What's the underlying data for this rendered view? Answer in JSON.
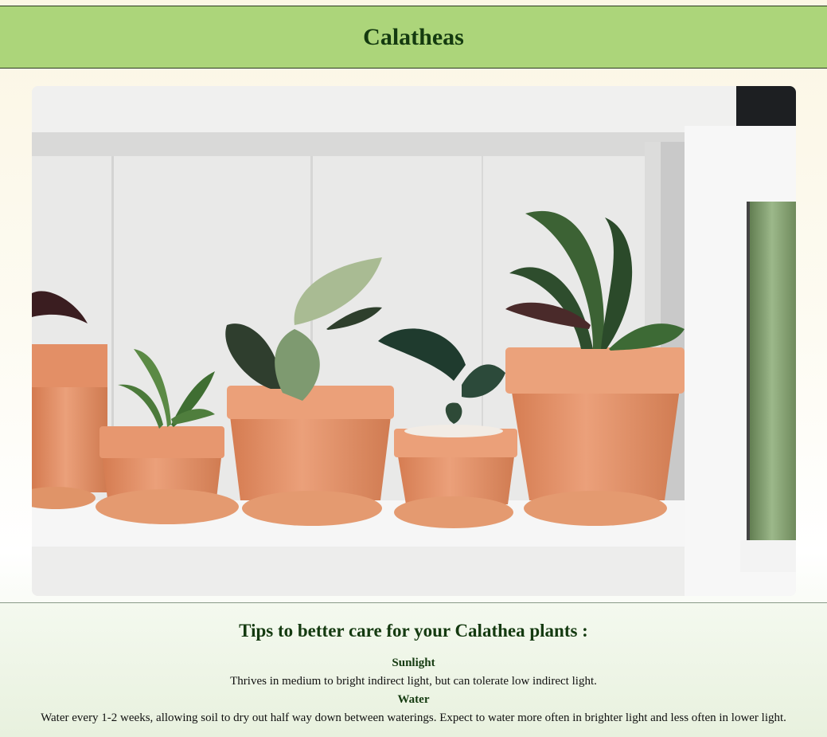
{
  "header": {
    "title": "Calatheas"
  },
  "hero_image": {
    "alt": "Calathea plants in terracotta pots on a white shelf"
  },
  "tips": {
    "heading": "Tips to better care for your Calathea plants :",
    "items": [
      {
        "title": "Sunlight",
        "text": "Thrives in medium to bright indirect light, but can tolerate low indirect light."
      },
      {
        "title": "Water",
        "text": "Water every 1-2 weeks, allowing soil to dry out half way down between waterings. Expect to water more often in brighter light and less often in lower light."
      }
    ]
  },
  "colors": {
    "header_bg": "#acd57a",
    "heading_text": "#143a10",
    "terracotta": "#e2936a"
  }
}
